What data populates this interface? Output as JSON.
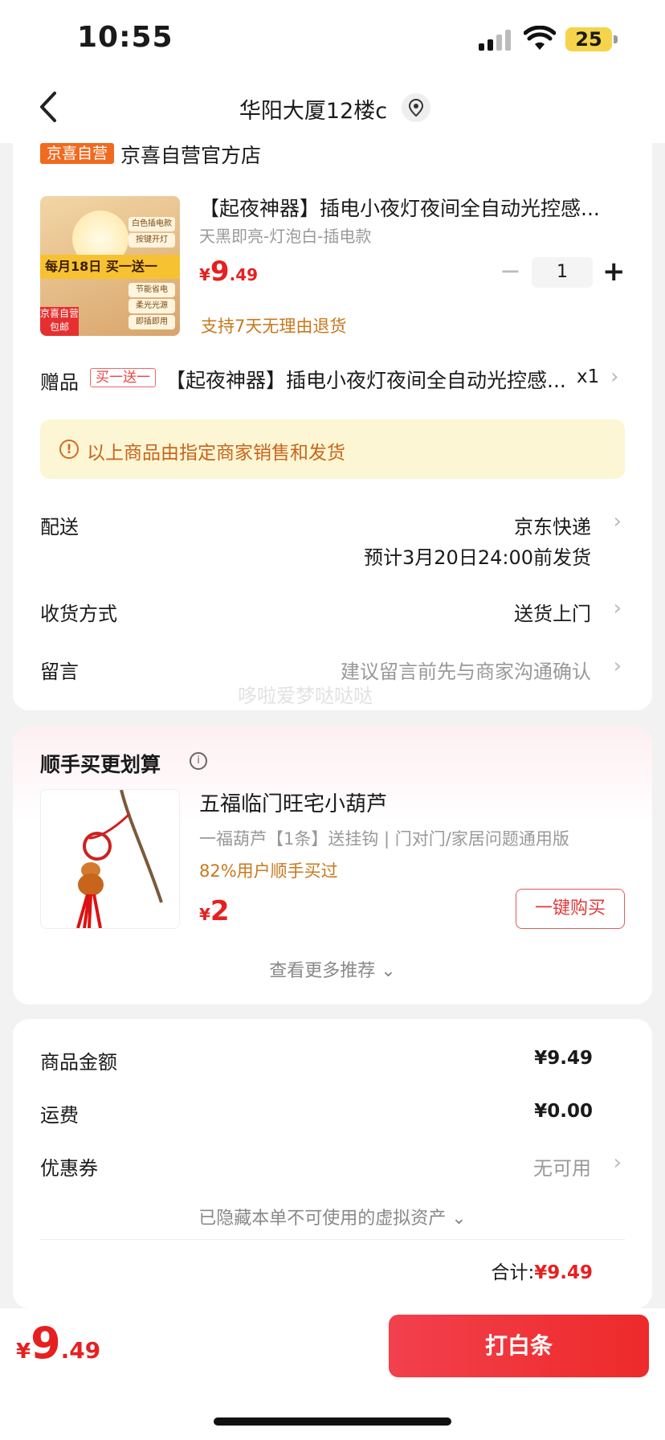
{
  "status_bar": {
    "time": "10:55",
    "battery": "25"
  },
  "nav": {
    "title": "华阳大厦12楼c"
  },
  "store": {
    "badge": "京喜自营",
    "name": "京喜自营官方店"
  },
  "product": {
    "image_promo": "每月18日 买一送一",
    "image_badges": [
      "白色插电款",
      "按键开灯",
      "节能省电",
      "柔光光源",
      "即插即用"
    ],
    "image_ship_tag": "京喜自营 包邮",
    "title": "【起夜神器】插电小夜灯夜间全自动光控感...",
    "spec": "天黑即亮-灯泡白-插电款",
    "price_symbol": "¥",
    "price_int": "9",
    "price_dec": ".49",
    "quantity": "1",
    "minus": "−",
    "plus": "+",
    "return_policy": "支持7天无理由退货"
  },
  "gift": {
    "label": "赠品",
    "tag": "买一送一",
    "title": "【起夜神器】插电小夜灯夜间全自动光控感...",
    "qty": "x1"
  },
  "notice": {
    "text": "以上商品由指定商家销售和发货"
  },
  "delivery": {
    "label": "配送",
    "carrier": "京东快递",
    "estimate": "预计3月20日24:00前发货"
  },
  "receive": {
    "label": "收货方式",
    "value": "送货上门"
  },
  "message": {
    "label": "留言",
    "placeholder": "建议留言前先与商家沟通确认"
  },
  "watermark": "哆啦爱梦哒哒哒",
  "recommend": {
    "title": "顺手买更划算",
    "item_name": "五福临门旺宅小葫芦",
    "item_spec": "一福葫芦【1条】送挂钩 | 门对门/家居问题通用版",
    "social_proof": "82%用户顺手买过",
    "price_symbol": "¥",
    "price": "2",
    "buy_button": "一键购买",
    "see_more": "查看更多推荐 ⌄"
  },
  "summary": {
    "goods_label": "商品金额",
    "goods_value": "¥9.49",
    "shipping_label": "运费",
    "shipping_value": "¥0.00",
    "coupon_label": "优惠券",
    "coupon_value": "无可用",
    "hidden_assets": "已隐藏本单不可使用的虚拟资产 ⌄",
    "total_label": "合计:",
    "total_value": "¥9.49"
  },
  "bottom": {
    "price_symbol": "¥",
    "price_int": "9",
    "price_dec": ".49",
    "pay_button": "打白条"
  },
  "colors": {
    "accent_red": "#e62020",
    "badge_orange": "#f06a1f",
    "notice_bg": "#fdf6d4"
  }
}
